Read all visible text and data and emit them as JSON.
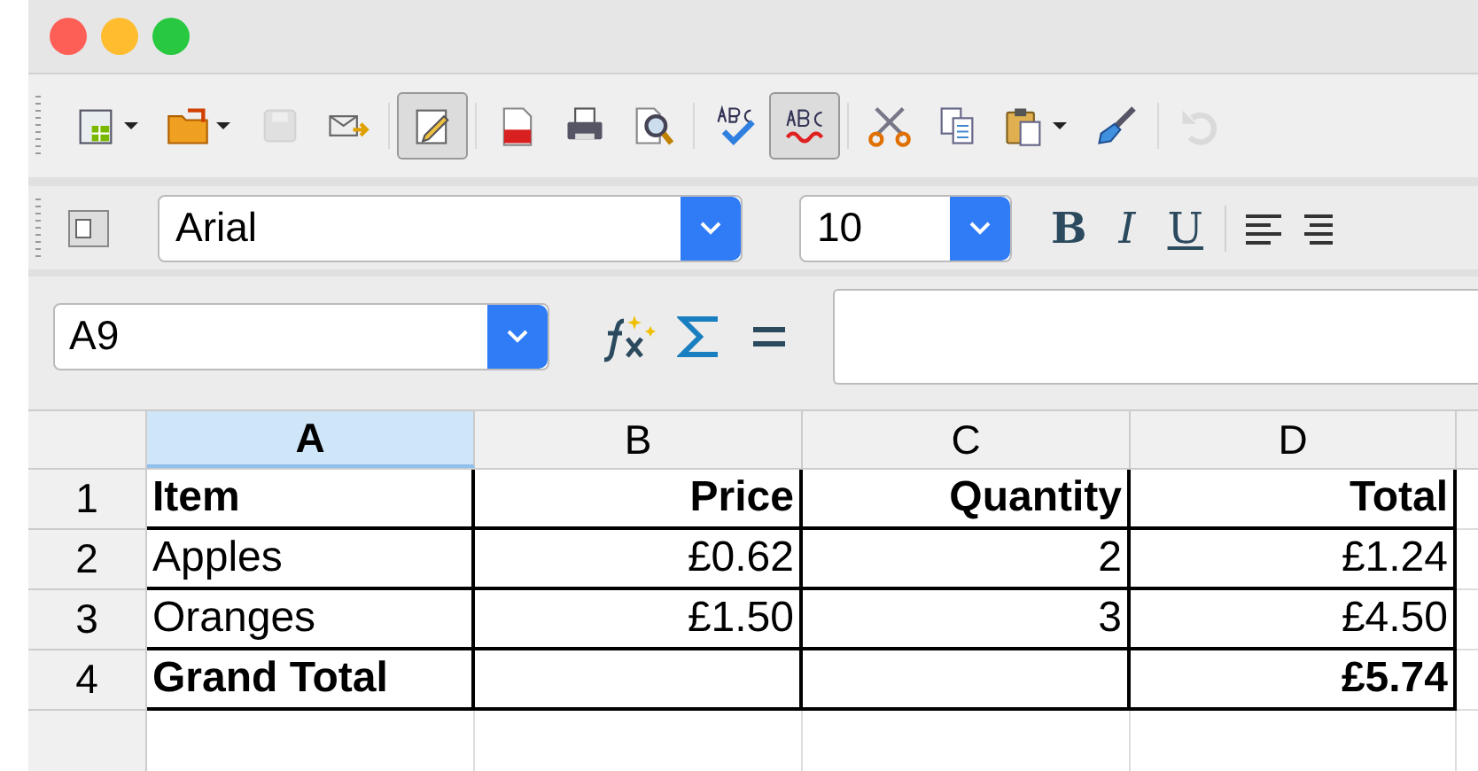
{
  "standard_toolbar": {
    "buttons": [
      {
        "pressed": false,
        "disabled": false,
        "dropdown": true
      },
      {
        "pressed": false,
        "disabled": false,
        "dropdown": true
      },
      {
        "pressed": false,
        "disabled": true,
        "dropdown": false
      },
      {
        "pressed": false,
        "disabled": false,
        "dropdown": false
      },
      {
        "pressed": true,
        "disabled": false,
        "dropdown": false
      },
      {
        "pressed": false,
        "disabled": false,
        "dropdown": false
      },
      {
        "pressed": false,
        "disabled": false,
        "dropdown": false
      },
      {
        "pressed": false,
        "disabled": false,
        "dropdown": false
      },
      {
        "pressed": false,
        "disabled": false,
        "dropdown": false
      },
      {
        "pressed": true,
        "disabled": false,
        "dropdown": false
      },
      {
        "pressed": false,
        "disabled": false,
        "dropdown": false
      },
      {
        "pressed": false,
        "disabled": false,
        "dropdown": false
      },
      {
        "pressed": false,
        "disabled": false,
        "dropdown": true
      },
      {
        "pressed": false,
        "disabled": false,
        "dropdown": false
      },
      {
        "pressed": false,
        "disabled": true,
        "dropdown": false
      }
    ]
  },
  "formatting_toolbar": {
    "font_name": "Arial",
    "font_size": "10",
    "style_buttons": [
      "B",
      "I",
      "U"
    ]
  },
  "formula_bar": {
    "name_box": "A9"
  },
  "sheet": {
    "columns": [
      {
        "label": "A",
        "selected": true
      },
      {
        "label": "B",
        "selected": false
      },
      {
        "label": "C",
        "selected": false
      },
      {
        "label": "D",
        "selected": false
      }
    ],
    "rows": [
      {
        "label": "1",
        "cells": [
          {
            "text": "Item",
            "bold": true,
            "kind": "text"
          },
          {
            "text": "Price",
            "bold": true,
            "kind": "number"
          },
          {
            "text": "Quantity",
            "bold": true,
            "kind": "number"
          },
          {
            "text": "Total",
            "bold": true,
            "kind": "number"
          }
        ]
      },
      {
        "label": "2",
        "cells": [
          {
            "text": "Apples",
            "bold": false,
            "kind": "text"
          },
          {
            "text": "£0.62",
            "bold": false,
            "kind": "number"
          },
          {
            "text": "2",
            "bold": false,
            "kind": "number"
          },
          {
            "text": "£1.24",
            "bold": false,
            "kind": "number"
          }
        ]
      },
      {
        "label": "3",
        "cells": [
          {
            "text": "Oranges",
            "bold": false,
            "kind": "text"
          },
          {
            "text": "£1.50",
            "bold": false,
            "kind": "number"
          },
          {
            "text": "3",
            "bold": false,
            "kind": "number"
          },
          {
            "text": "£4.50",
            "bold": false,
            "kind": "number"
          }
        ]
      },
      {
        "label": "4",
        "cells": [
          {
            "text": "Grand Total",
            "bold": true,
            "kind": "text"
          },
          {
            "text": ""
          },
          {
            "text": ""
          },
          {
            "text": "£5.74",
            "bold": true,
            "kind": "number"
          }
        ]
      }
    ]
  }
}
